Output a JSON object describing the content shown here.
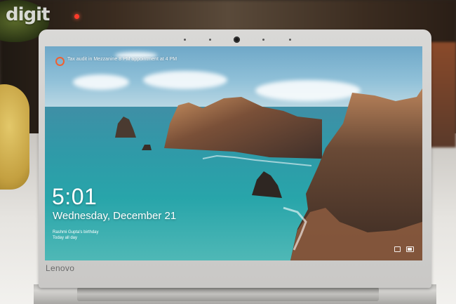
{
  "brand_logo": "digit",
  "laptop": {
    "logo": "Lenovo"
  },
  "lockscreen": {
    "reminder": "Tax audit in Mezzanine 8 PM appointment at 4 PM",
    "time": "5:01",
    "date": "Wednesday, December 21",
    "event": {
      "title": "Rashmi Gupta's birthday",
      "subtitle": "Today all day"
    },
    "tray_icons": [
      "network-icon",
      "battery-icon"
    ]
  },
  "colors": {
    "cortana_accent": "#f06030",
    "lid": "#d9d8d6",
    "sea": "#2f9aa8"
  }
}
